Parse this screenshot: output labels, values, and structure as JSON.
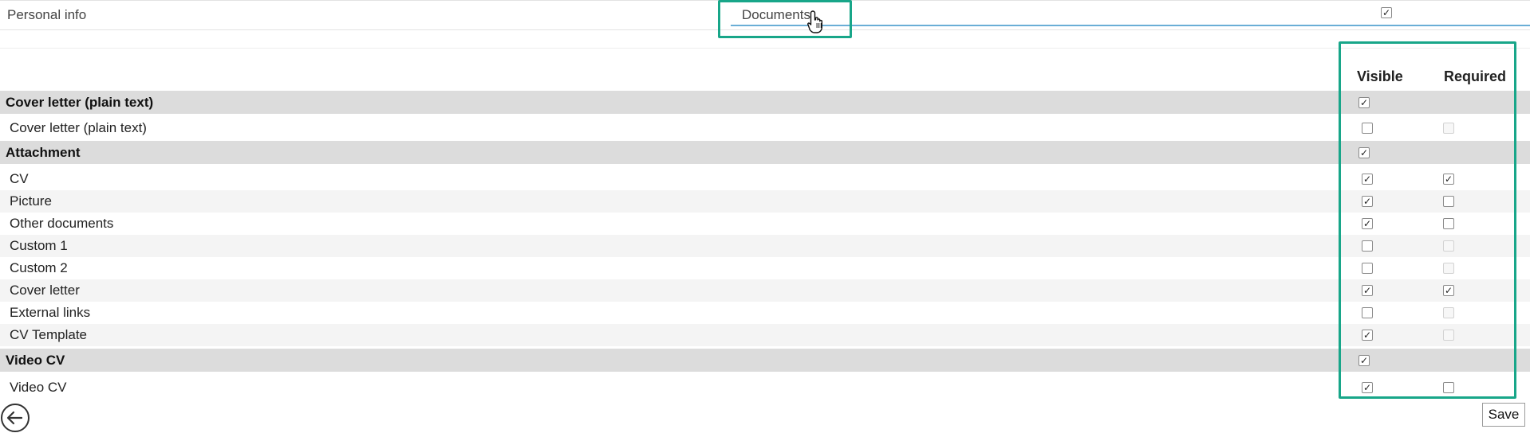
{
  "top": {
    "label": "Personal info",
    "input_value": "Documents",
    "checked": true
  },
  "columns": {
    "visible": "Visible",
    "required": "Required"
  },
  "rows": [
    {
      "type": "section",
      "label": "Cover letter (plain text)",
      "visible": true
    },
    {
      "type": "item",
      "label": "Cover letter (plain text)",
      "visible": false,
      "required": false,
      "required_disabled": true
    },
    {
      "type": "section",
      "label": "Attachment",
      "visible": true
    },
    {
      "type": "item",
      "label": "CV",
      "visible": true,
      "required": true,
      "required_disabled": false
    },
    {
      "type": "item",
      "label": "Picture",
      "visible": true,
      "required": false,
      "required_disabled": false
    },
    {
      "type": "item",
      "label": "Other documents",
      "visible": true,
      "required": false,
      "required_disabled": false
    },
    {
      "type": "item",
      "label": "Custom 1",
      "visible": false,
      "required": false,
      "required_disabled": true
    },
    {
      "type": "item",
      "label": "Custom 2",
      "visible": false,
      "required": false,
      "required_disabled": true
    },
    {
      "type": "item",
      "label": "Cover letter",
      "visible": true,
      "required": true,
      "required_disabled": false
    },
    {
      "type": "item",
      "label": "External links",
      "visible": false,
      "required": false,
      "required_disabled": true
    },
    {
      "type": "item",
      "label": "CV Template",
      "visible": true,
      "required": false,
      "required_disabled": true
    },
    {
      "type": "section",
      "label": "Video CV",
      "visible": true
    },
    {
      "type": "item",
      "label": "Video CV",
      "visible": true,
      "required": false,
      "required_disabled": false
    }
  ],
  "actions": {
    "save_label": "Save"
  },
  "colors": {
    "highlight": "#18a689",
    "section_bg": "#dcdcdc",
    "input_underline": "#6aaed6"
  },
  "icons": {
    "back": "back-arrow-circle-icon",
    "cursor": "hand-pointer-icon",
    "check": "checkmark"
  }
}
